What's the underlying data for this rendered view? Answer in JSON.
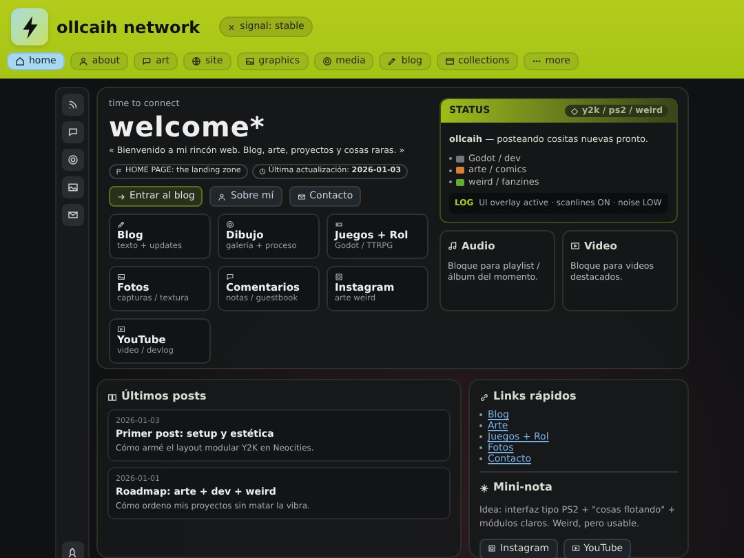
{
  "site": {
    "title": "ollcaih network",
    "badge": "signal: stable"
  },
  "nav": [
    {
      "label": "home",
      "selected": true
    },
    {
      "label": "about",
      "selected": false
    },
    {
      "label": "art",
      "selected": false
    },
    {
      "label": "site",
      "selected": false
    },
    {
      "label": "graphics",
      "selected": false
    },
    {
      "label": "media",
      "selected": false
    },
    {
      "label": "blog",
      "selected": false
    },
    {
      "label": "collections",
      "selected": false
    },
    {
      "label": "more",
      "selected": false
    }
  ],
  "hero": {
    "kicker": "time to connect",
    "title": "welcome*",
    "subtitle": "« Bienvenido a mi rincón web. Blog, arte, proyectos y cosas raras. »",
    "chips": [
      "HOME PAGE: the landing zone",
      "Última actualización: **2026-01-03**"
    ],
    "buttons": [
      {
        "label": "Entrar al blog",
        "kind": "primary"
      },
      {
        "label": "Sobre mí",
        "kind": "secondary"
      },
      {
        "label": "Contacto",
        "kind": "secondary"
      }
    ]
  },
  "tiles": [
    {
      "title": "Blog",
      "subtitle": "texto + updates"
    },
    {
      "title": "Dibujo",
      "subtitle": "galería + proceso"
    },
    {
      "title": "Juegos + Rol",
      "subtitle": "Godot / TTRPG"
    },
    {
      "title": "Fotos",
      "subtitle": "capturas / textura"
    },
    {
      "title": "Comentarios",
      "subtitle": "notas / guestbook"
    },
    {
      "title": "Instagram",
      "subtitle": "arte weird"
    },
    {
      "title": "YouTube",
      "subtitle": "video / devlog"
    }
  ],
  "status": {
    "title": "STATUS",
    "tag": "y2k / ps2 / weird",
    "message": "**ollcaih** — posteando cositas nuevas pronto.",
    "items": [
      "Godot / dev",
      "arte / comics",
      "weird / fanzines"
    ],
    "log_label": "LOG",
    "log": "UI overlay active · scanlines ON · noise LOW"
  },
  "media": [
    {
      "title": "Audio",
      "text": "Bloque para playlist / álbum del momento."
    },
    {
      "title": "Video",
      "text": "Bloque para videos destacados."
    }
  ],
  "posts": {
    "title": "Últimos posts",
    "items": [
      {
        "date": "2026-01-03",
        "title": "Primer post: setup y estética",
        "summary": "Cómo armé el layout modular Y2K en Neocities."
      },
      {
        "date": "2026-01-01",
        "title": "Roadmap: arte + dev + weird",
        "summary": "Cómo ordeno mis proyectos sin matar la vibra."
      }
    ]
  },
  "links": {
    "title": "Links rápidos",
    "items": [
      "Blog",
      "Arte",
      "Juegos + Rol",
      "Fotos",
      "Contacto"
    ]
  },
  "note": {
    "title": "Mini-nota",
    "text": "Idea: interfaz tipo PS2 + \"cosas flotando\" + módulos claros. Weird, pero usable.",
    "buttons": [
      "Instagram",
      "YouTube"
    ]
  }
}
